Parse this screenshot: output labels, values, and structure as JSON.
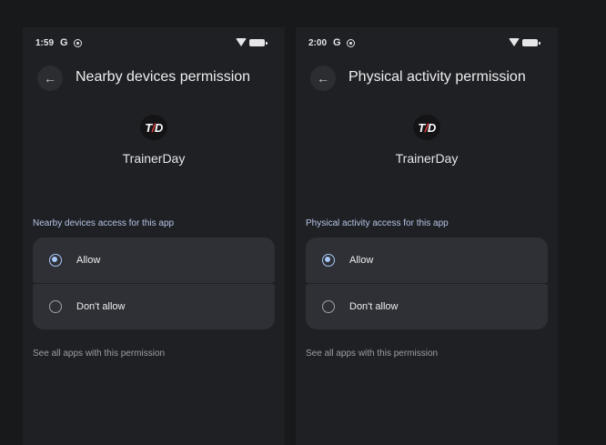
{
  "screens": [
    {
      "status": {
        "time": "1:59",
        "google_glyph": "G"
      },
      "title": "Nearby devices permission",
      "back_icon": "arrow-back-icon",
      "app": {
        "logo_left": "T",
        "logo_slash": "/",
        "logo_right": "D",
        "name": "TrainerDay"
      },
      "section_label": "Nearby devices access for this app",
      "options": [
        {
          "label": "Allow",
          "selected": true
        },
        {
          "label": "Don't allow",
          "selected": false
        }
      ],
      "see_all_link": "See all apps with this permission"
    },
    {
      "status": {
        "time": "2:00",
        "google_glyph": "G"
      },
      "title": "Physical activity permission",
      "back_icon": "arrow-back-icon",
      "app": {
        "logo_left": "T",
        "logo_slash": "/",
        "logo_right": "D",
        "name": "TrainerDay"
      },
      "section_label": "Physical activity access for this app",
      "options": [
        {
          "label": "Allow",
          "selected": true
        },
        {
          "label": "Don't allow",
          "selected": false
        }
      ],
      "see_all_link": "See all apps with this permission"
    }
  ],
  "colors": {
    "background": "#18191b",
    "surface": "#1f2024",
    "option_bg": "#2e3035",
    "accent": "#a8c7fa",
    "logo_accent": "#e53935"
  }
}
